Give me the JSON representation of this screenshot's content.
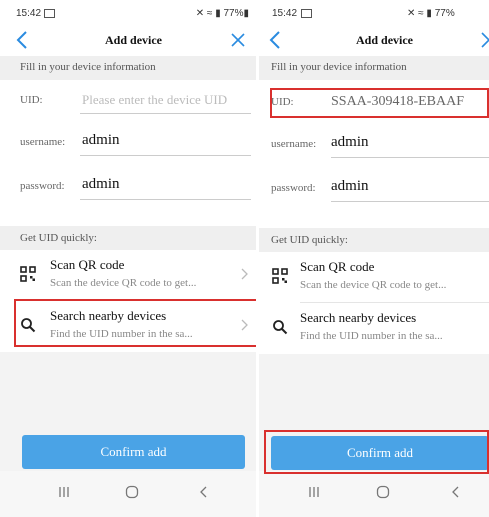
{
  "left": {
    "status": {
      "time": "15:42",
      "icons": "✕ ≈ ▮ 77%▮"
    },
    "title": "Add device",
    "section_info": "Fill in your device information",
    "uid_label": "UID:",
    "uid_placeholder": "Please enter the device UID",
    "username_label": "username:",
    "username_value": "admin",
    "password_label": "password:",
    "password_value": "admin",
    "section_quick": "Get UID quickly:",
    "scan_title": "Scan QR code",
    "scan_sub": "Scan the device QR code to get...",
    "search_title": "Search nearby devices",
    "search_sub": "Find the UID number in the sa...",
    "confirm": "Confirm add"
  },
  "right": {
    "status": {
      "time": "15:42",
      "icons": "✕ ≈ ▮ 77%"
    },
    "title": "Add device",
    "section_info": "Fill in your device information",
    "uid_label": "UID:",
    "uid_value": "SSAA-309418-EBAAF",
    "username_label": "username:",
    "username_value": "admin",
    "password_label": "password:",
    "password_value": "admin",
    "section_quick": "Get UID quickly:",
    "scan_title": "Scan QR code",
    "scan_sub": "Scan the device QR code to get...",
    "search_title": "Search nearby devices",
    "search_sub": "Find the UID number in the sa...",
    "confirm": "Confirm add"
  },
  "colors": {
    "accent": "#4aa3e6",
    "highlight": "#d9302e",
    "background": "#f3f3f3"
  },
  "icons": [
    "back-arrow-icon",
    "close-icon",
    "qr-code-icon",
    "search-icon",
    "chevron-right-icon",
    "recents-nav-icon",
    "home-nav-icon",
    "back-nav-icon"
  ]
}
